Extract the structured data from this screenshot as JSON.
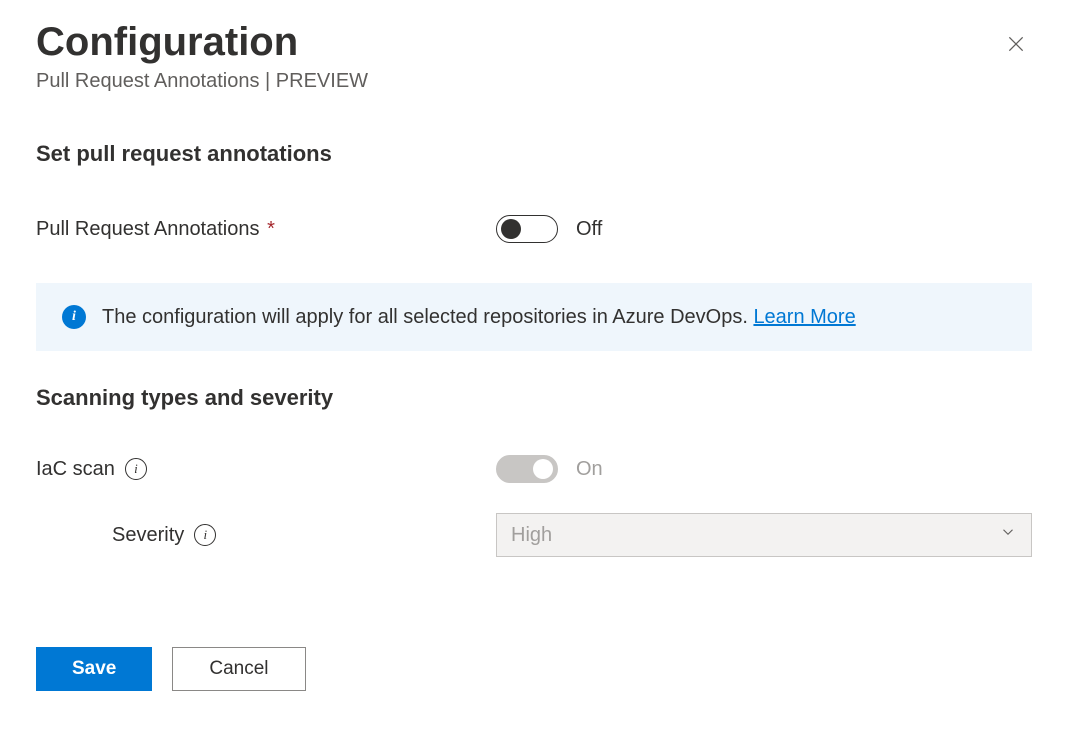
{
  "header": {
    "title": "Configuration",
    "subtitle": "Pull Request Annotations | PREVIEW"
  },
  "sections": {
    "pr_annotations": {
      "heading": "Set pull request annotations",
      "label": "Pull Request Annotations",
      "required_marker": "*",
      "toggle_state": "Off"
    },
    "info": {
      "text": "The configuration will apply for all selected repositories in Azure DevOps. ",
      "link_text": "Learn More"
    },
    "scanning": {
      "heading": "Scanning types and severity",
      "iac_label": "IaC scan",
      "iac_toggle_state": "On",
      "severity_label": "Severity",
      "severity_value": "High"
    }
  },
  "footer": {
    "save": "Save",
    "cancel": "Cancel"
  }
}
